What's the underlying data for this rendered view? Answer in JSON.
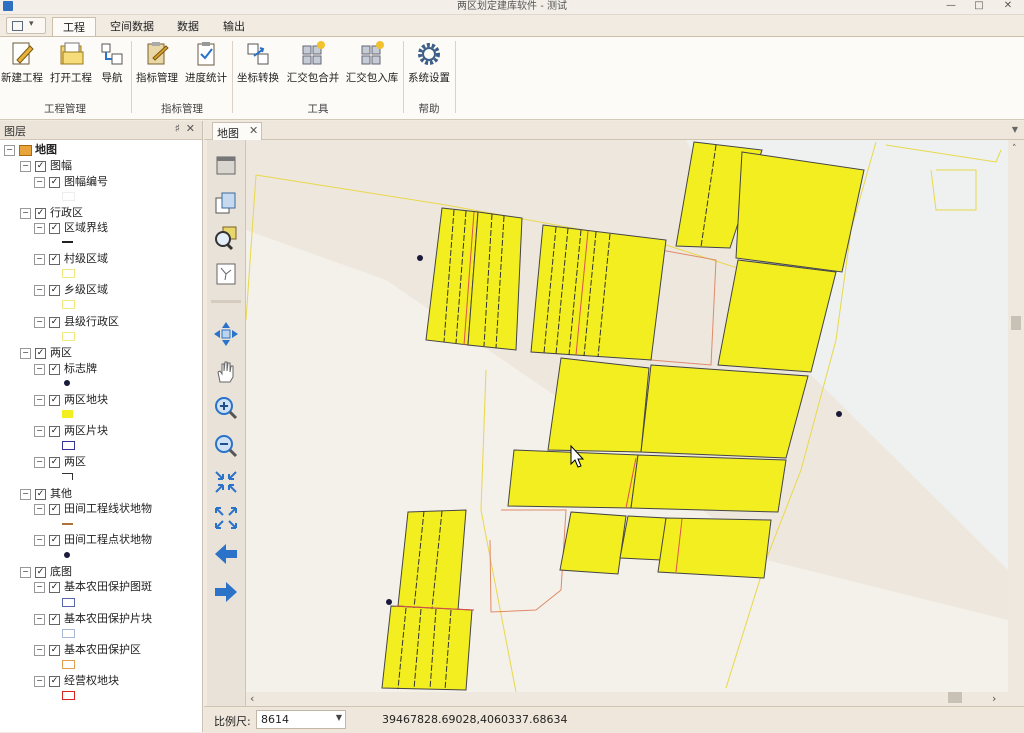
{
  "window": {
    "title": "两区划定建库软件 - 测试",
    "minimize": "—",
    "maximize": "□",
    "close": "✕"
  },
  "ribbon": {
    "tabs": [
      "工程",
      "空间数据",
      "数据",
      "输出"
    ],
    "active_tab": "工程",
    "groups": [
      {
        "label": "工程管理",
        "buttons": [
          "新建工程",
          "打开工程",
          "导航"
        ]
      },
      {
        "label": "指标管理",
        "buttons": [
          "指标管理",
          "进度统计"
        ]
      },
      {
        "label": "工具",
        "buttons": [
          "坐标转换",
          "汇交包合并",
          "汇交包入库"
        ]
      },
      {
        "label": "帮助",
        "buttons": [
          "系统设置"
        ]
      }
    ]
  },
  "layer_panel": {
    "title": "图层",
    "pin": "♯",
    "close": "✕",
    "root": "地图",
    "groups": [
      {
        "name": "图幅",
        "layers": [
          {
            "name": "图幅编号",
            "symbol": "blank"
          }
        ]
      },
      {
        "name": "行政区",
        "layers": [
          {
            "name": "区域界线",
            "symbol": "dash"
          },
          {
            "name": "村级区域",
            "symbol": "yellow-outline"
          },
          {
            "name": "乡级区域",
            "symbol": "yellow-outline"
          },
          {
            "name": "县级行政区",
            "symbol": "yellow-outline"
          }
        ]
      },
      {
        "name": "两区",
        "layers": [
          {
            "name": "标志牌",
            "symbol": "dot"
          },
          {
            "name": "两区地块",
            "symbol": "yellow-fill"
          },
          {
            "name": "两区片块",
            "symbol": "blue-outline"
          },
          {
            "name": "两区",
            "symbol": "corner"
          }
        ]
      },
      {
        "name": "其他",
        "layers": [
          {
            "name": "田间工程线状地物",
            "symbol": "brown-line"
          },
          {
            "name": "田间工程点状地物",
            "symbol": "dot"
          }
        ]
      },
      {
        "name": "底图",
        "layers": [
          {
            "name": "基本农田保护图斑",
            "symbol": "blue-outline"
          },
          {
            "name": "基本农田保护片块",
            "symbol": "lightblue-outline"
          },
          {
            "name": "基本农田保护区",
            "symbol": "orange-outline"
          },
          {
            "name": "经营权地块",
            "symbol": "red-outline"
          }
        ]
      }
    ]
  },
  "map": {
    "tab_label": "地图",
    "tab_close": "✕",
    "parcel_fill": "#f2ee1f",
    "background": "#eee7de"
  },
  "status": {
    "scale_label": "比例尺:",
    "scale_value": "8614",
    "coordinates": "39467828.69028,4060337.68634"
  },
  "colors": {
    "ribbon_bg": "#fdfbf7",
    "chrome_bg": "#f1ebe2",
    "accent_blue": "#2b72c9",
    "parcel_yellow": "#f2ee1f"
  }
}
